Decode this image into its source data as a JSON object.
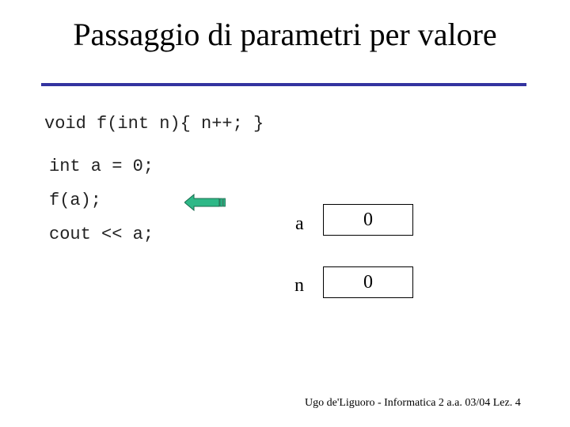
{
  "slide": {
    "title": "Passaggio di parametri per valore",
    "accent_color": "#3333a0",
    "code": {
      "function_def": "void f(int n){ n++; }",
      "lines": [
        "int a = 0;",
        "f(a);",
        "cout << a;"
      ]
    },
    "arrow": {
      "icon": "left-arrow-icon",
      "color": "#2eb887",
      "points_to": "f(a);"
    },
    "variables": [
      {
        "name": "a",
        "value": "0"
      },
      {
        "name": "n",
        "value": "0"
      }
    ],
    "footer": "Ugo de'Liguoro - Informatica 2 a.a. 03/04 Lez. 4"
  }
}
